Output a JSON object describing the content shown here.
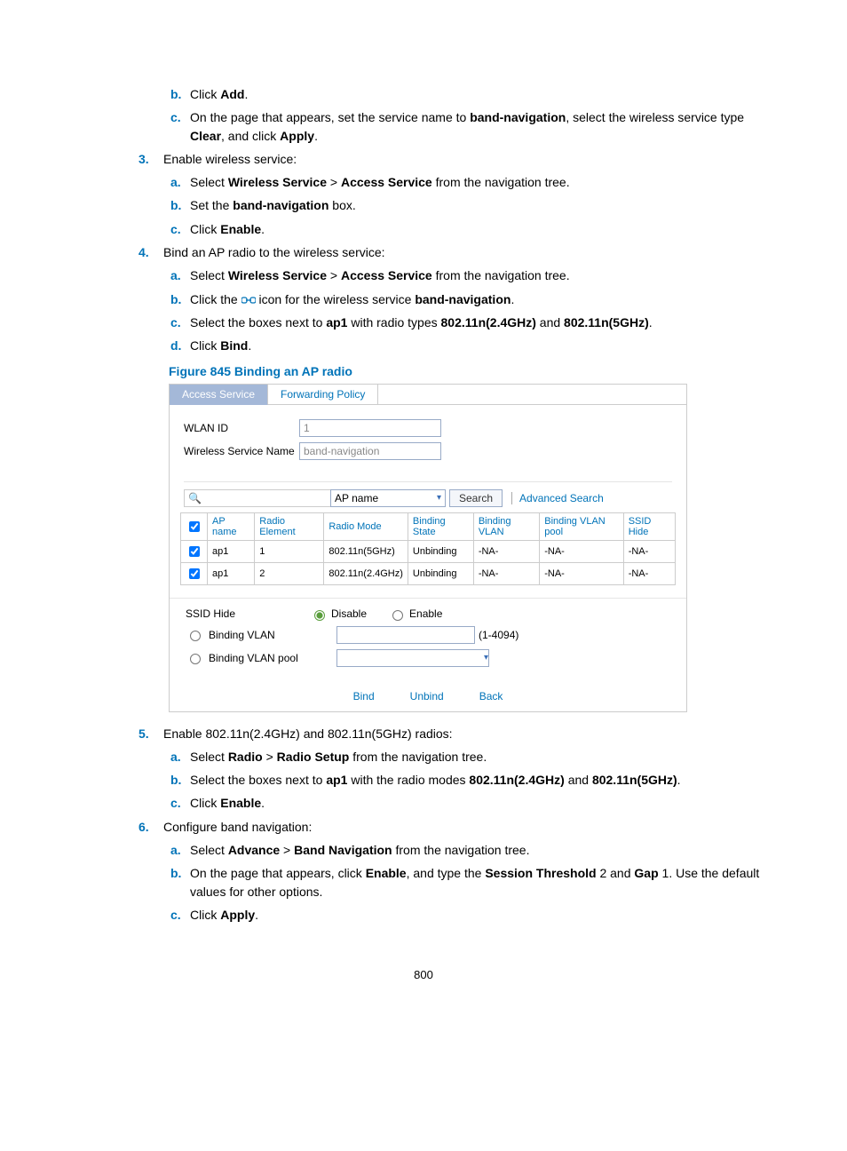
{
  "steps": {
    "s_b": {
      "marker": "b.",
      "pre": "Click ",
      "bold1": "Add",
      "post": "."
    },
    "s_c": {
      "marker": "c.",
      "pre": "On the page that appears, set the service name to ",
      "bold1": "band-navigation",
      "mid1": ", select the wireless service type ",
      "bold2": "Clear",
      "mid2": ", and click ",
      "bold3": "Apply",
      "post": "."
    },
    "n3": {
      "marker": "3.",
      "text": "Enable wireless service:"
    },
    "n3a": {
      "marker": "a.",
      "pre": "Select ",
      "bold1": "Wireless Service",
      "sep": " > ",
      "bold2": "Access Service",
      "post": " from the navigation tree."
    },
    "n3b": {
      "marker": "b.",
      "pre": "Set the ",
      "bold1": "band-navigation",
      "post": " box."
    },
    "n3c": {
      "marker": "c.",
      "pre": "Click ",
      "bold1": "Enable",
      "post": "."
    },
    "n4": {
      "marker": "4.",
      "text": "Bind an AP radio to the wireless service:"
    },
    "n4a": {
      "marker": "a.",
      "pre": "Select ",
      "bold1": "Wireless Service",
      "sep": " > ",
      "bold2": "Access Service",
      "post": " from the navigation tree."
    },
    "n4b": {
      "marker": "b.",
      "pre": "Click the ",
      "post_icon": " icon for the wireless service ",
      "bold1": "band-navigation",
      "post": "."
    },
    "n4c": {
      "marker": "c.",
      "pre": "Select the boxes next to ",
      "bold1": "ap1",
      "mid1": " with radio types ",
      "bold2": "802.11n(2.4GHz)",
      "mid2": " and ",
      "bold3": "802.11n(5GHz)",
      "post": "."
    },
    "n4d": {
      "marker": "d.",
      "pre": "Click ",
      "bold1": "Bind",
      "post": "."
    },
    "n5": {
      "marker": "5.",
      "text": "Enable 802.11n(2.4GHz) and 802.11n(5GHz) radios:"
    },
    "n5a": {
      "marker": "a.",
      "pre": "Select ",
      "bold1": "Radio",
      "sep": " > ",
      "bold2": "Radio Setup",
      "post": " from the navigation tree."
    },
    "n5b": {
      "marker": "b.",
      "pre": "Select the boxes next to ",
      "bold1": "ap1",
      "mid1": " with the radio modes ",
      "bold2": "802.11n(2.4GHz)",
      "mid2": " and ",
      "bold3": "802.11n(5GHz)",
      "post": "."
    },
    "n5c": {
      "marker": "c.",
      "pre": "Click ",
      "bold1": "Enable",
      "post": "."
    },
    "n6": {
      "marker": "6.",
      "text": "Configure band navigation:"
    },
    "n6a": {
      "marker": "a.",
      "pre": "Select ",
      "bold1": "Advance",
      "sep": " > ",
      "bold2": "Band Navigation",
      "post": " from the navigation tree."
    },
    "n6b": {
      "marker": "b.",
      "pre": "On the page that appears, click ",
      "bold1": "Enable",
      "mid1": ", and type the ",
      "bold2": "Session Threshold",
      "mid2": " 2 and ",
      "bold3": "Gap",
      "post": " 1. Use the default values for other options."
    },
    "n6c": {
      "marker": "c.",
      "pre": "Click ",
      "bold1": "Apply",
      "post": "."
    }
  },
  "figure_caption": "Figure 845 Binding an AP radio",
  "ui": {
    "tabs": {
      "active": "Access Service",
      "other": "Forwarding Policy"
    },
    "wlan_id_label": "WLAN ID",
    "wlan_id_value": "1",
    "service_name_label": "Wireless Service Name",
    "service_name_value": "band-navigation",
    "search_dropdown": "AP name",
    "search_btn": "Search",
    "advanced": "Advanced Search",
    "headers": [
      "",
      "AP name",
      "Radio Element",
      "Radio Mode",
      "Binding State",
      "Binding VLAN",
      "Binding VLAN pool",
      "SSID Hide"
    ],
    "rows": [
      {
        "checked": true,
        "ap": "ap1",
        "re": "1",
        "mode": "802.11n(5GHz)",
        "state": "Unbinding",
        "bvlan": "-NA-",
        "bpool": "-NA-",
        "hide": "-NA-"
      },
      {
        "checked": true,
        "ap": "ap1",
        "re": "2",
        "mode": "802.11n(2.4GHz)",
        "state": "Unbinding",
        "bvlan": "-NA-",
        "bpool": "-NA-",
        "hide": "-NA-"
      }
    ],
    "ssid_hide_label": "SSID Hide",
    "disable": "Disable",
    "enable": "Enable",
    "binding_vlan": "Binding VLAN",
    "vlan_range": "(1-4094)",
    "binding_pool": "Binding VLAN pool",
    "bind_btn": "Bind",
    "unbind_btn": "Unbind",
    "back_btn": "Back"
  },
  "page_number": "800"
}
